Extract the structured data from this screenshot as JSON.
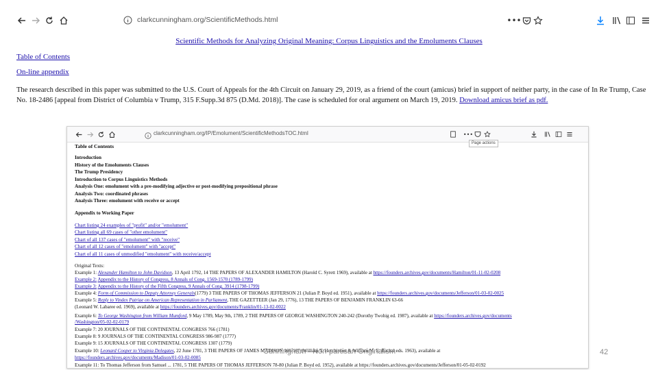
{
  "browser": {
    "url": "clarkcunningham.org/ScientificMethods.html",
    "icons": {
      "back": "back-arrow-icon",
      "forward": "forward-arrow-icon",
      "reload": "reload-icon",
      "home": "home-icon",
      "info": "info-icon",
      "more": "more-icon",
      "pocket": "pocket-icon",
      "bookmark": "star-icon",
      "download": "download-icon",
      "library": "library-icon",
      "sidebar": "sidebar-icon",
      "menu": "hamburger-menu-icon"
    }
  },
  "page": {
    "title": "Scientific Methods for Analyzing Original Meaning: Corpus Linguistics and the Emoluments Clauses",
    "toc_link": "Table of Contents",
    "appendix_link": "On-line appendix",
    "paragraph_text": "The research described in this paper was submitted to the U.S. Court of Appeals for the 4th Circuit on January 29, 2019, as a friend of the court (amicus) brief in support of neither party, in the case of In Re Trump, Case No. 18-2486 [appeal from District of Columbia v Trump, 315 F.Supp.3d 875 (D.Md. 2018)]. The case is scheduled for oral argument on March 19, 2019.",
    "download_link": "Download amicus brief as pdf."
  },
  "inner": {
    "url": "clarkcunningham.org/IP/Emolument/ScientificMethodsTOC.html",
    "page_actions": "Page actions",
    "toc_heading": "Table of Contents",
    "sections": [
      "Introduction",
      "History of the Emoluments Clauses",
      "The Trump Presidency",
      "Introduction to Corpus Linguistics Methods",
      "Analysis One: emolument with a pre-modifying adjective or post-modifying prepositional phrase",
      "Analysis Two: coordinated phrases",
      "Analysis Three: emolument with receive or accept"
    ],
    "appendix_heading": "Appendix to Working Paper",
    "charts": [
      "Chart listing 24 examples of \"profit\" and/or \"emolument\"",
      "Chart listing all 69 cases of \"other emolument\"",
      "Chart of all 137 cases of \"emolument\" with \"receive\"",
      "Chart of all 12 cases of \"emolument\" with \"accept\"",
      "Chart of all 11 cases of unmodified \"emolument\" with receive/accept"
    ],
    "original_texts_label": "Original Texts:",
    "examples": [
      {
        "label": "Example 1:",
        "link": "Alexander Hamilton to John Davidson",
        "text": ", 13 April 1792, 14 THE PAPERS OF ALEXANDER HAMILTON (Harold C. Syrett 1969), available at ",
        "url": "https://founders.archives.gov/documents/Hamilton/01-11-02-0208"
      },
      {
        "label": "Example 2:",
        "link": "Appendix to the History of Congress, 8 Annals of Cong. 1569-1570 (1789-1799)",
        "text": "",
        "url": ""
      },
      {
        "label": "Example 3:",
        "link": "Appendix to the History of the Fifth Congress, 9 Annals of Cong. 3914 (1798-1799)",
        "text": "",
        "url": ""
      },
      {
        "label": "Example 4:",
        "link": "Form of Commission to Deputy Attorney Generals",
        "text": "(1779) 3 THE PAPERS OF THOMAS JEFFERSON 21 (Julian P. Boyd ed. 1951), available at ",
        "url": "https://founders.archives.gov/documents/Jefferson/01-03-02-0025"
      },
      {
        "label": "Example 5:",
        "link": "Reply to Vindex Patriae on American Representation in Parliament",
        "text": ", THE GAZETTEER (Jan 29, 1776), 13 THE PAPERS OF BENJAMIN FRANKLIN 63-66",
        "url": ""
      }
    ],
    "example5_cont_text": "(Leonard W. Labaree ed. 1969), available at ",
    "example5_cont_url": "https://founders.archives.gov/documents/Franklin/01-13-02-0022",
    "example6": {
      "label": "Example 6:",
      "link": "To George Washington from William Mumford",
      "text": ", 9 May 1789, May 9th, 1789, 2 THE PAPERS OF GEORGE WASHINGTON 240-242 (Dorothy Twohig ed. 1987), available at ",
      "url": "https://founders.archives.gov/documents"
    },
    "example6_cont_url": "/Washington/05-02-02-0179",
    "examples_b": [
      "Example 7: 20 JOURNALS OF THE CONTINENTAL CONGRESS 766 (1781)",
      "Example 8: 9 JOURNALS OF THE CONTINENTAL CONGRESS 986-987 (1777)",
      "Example 9: 15 JOURNALS OF THE CONTINENTAL CONGRESS 1307 (1779)"
    ],
    "example10": {
      "label": "Example 10:",
      "link": "Leonard Cooper to Virginia Delegates",
      "text": ", 22 June 1781, 3 THE PAPERS OF JAMES MADISON 166-167 (William T. Hutchinson & William M. E. Rachal eds. 1963), available at"
    },
    "example10_cont_url": "https://founders.archives.gov/documents/Madison/01-03-02-0085",
    "example11_partial": "Example 11: To Thomas Jefferson from Samuel ... 1781, 5 THE PAPERS OF THOMAS JEFFERSON 78-80 (Julian P. Boyd ed. 1952), available at https://founders.archives.gov/documents/Jefferson/01-05-02-0192"
  },
  "footer": {
    "text": "Cunningham - Non-partisan Originalism",
    "slide_number": "42"
  }
}
